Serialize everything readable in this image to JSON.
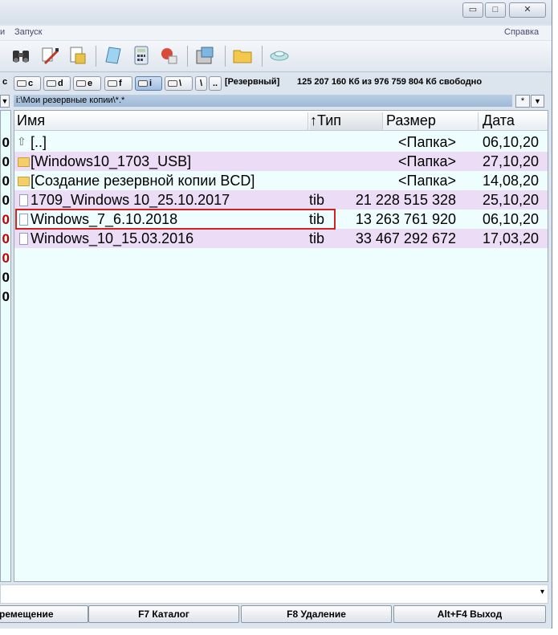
{
  "window": {
    "minimize_label": "▭",
    "maximize_label": "□",
    "close_label": "✕"
  },
  "menu": {
    "left_partial": "и",
    "launch": "Запуск",
    "help": "Справка"
  },
  "drives": {
    "c_partial": "c",
    "items": [
      "c",
      "d",
      "e",
      "f",
      "i",
      "\\",
      "\\",
      ".."
    ],
    "volume_label": "[Резервный]",
    "free_space": "125 207 160 Кб из 976 759 804 Кб свободно"
  },
  "path": {
    "text": "i:\\Мои резервные копии\\*.*",
    "star_button": "*",
    "dropdown": "▼"
  },
  "columns": {
    "name": "Имя",
    "type": "↑Тип",
    "size": "Размер",
    "date": "Дата"
  },
  "files": [
    {
      "icon": "up-dir-icon",
      "name": "[..]",
      "ext": "",
      "size": "<Папка>",
      "date": "06,10,20"
    },
    {
      "icon": "folder-icon",
      "name": "[Windows10_1703_USB]",
      "ext": "",
      "size": "<Папка>",
      "date": "27,10,20"
    },
    {
      "icon": "folder-icon",
      "name": "[Создание резервной копии BCD]",
      "ext": "",
      "size": "<Папка>",
      "date": "14,08,20"
    },
    {
      "icon": "file-icon",
      "name": "1709_Windows 10_25.10.2017",
      "ext": "tib",
      "size": "21 228 515 328",
      "date": "25,10,20"
    },
    {
      "icon": "file-icon",
      "name": "Windows_7_6.10.2018",
      "ext": "tib",
      "size": "13 263 761 920",
      "date": "06,10,20"
    },
    {
      "icon": "file-icon",
      "name": "Windows_10_15.03.2016",
      "ext": "tib",
      "size": "33 467 292 672",
      "date": "17,03,20"
    }
  ],
  "left_panel_digits": [
    "0",
    "0",
    "0",
    "0",
    "0",
    "0",
    "0",
    "0",
    "0"
  ],
  "fkeys": {
    "f6_partial": "ремещение",
    "f7": "F7 Каталог",
    "f8": "F8 Удаление",
    "altf4": "Alt+F4 Выход"
  },
  "colors": {
    "row_alt": "#ecdcf6",
    "panel_bg": "#eefefe",
    "highlight": "#d42020",
    "left_red": "#c00000"
  }
}
